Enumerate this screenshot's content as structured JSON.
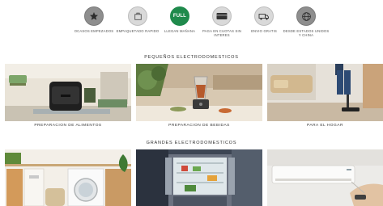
{
  "features": [
    {
      "icon": "star-icon",
      "label": "Ocasos empezados"
    },
    {
      "icon": "package-icon",
      "label": "Empaquetado rapido"
    },
    {
      "icon": "full-badge-icon",
      "badge": "FULL",
      "label": "Llegan mañana"
    },
    {
      "icon": "credit-card-icon",
      "label": "Paga en cuotas sin interes"
    },
    {
      "icon": "truck-icon",
      "label": "Envio gratis"
    },
    {
      "icon": "globe-icon",
      "label": "Desde Estados Unidos y China"
    }
  ],
  "small_appliances": {
    "title": "Pequeños electrodomesticos",
    "cards": [
      {
        "caption": "Preparacion de alimentos"
      },
      {
        "caption": "Preparacion de bebidas"
      },
      {
        "caption": "Para el hogar"
      }
    ]
  },
  "large_appliances": {
    "title": "Grandes electrodomesticos"
  },
  "colors": {
    "accent_green": "#1f8a4c"
  }
}
